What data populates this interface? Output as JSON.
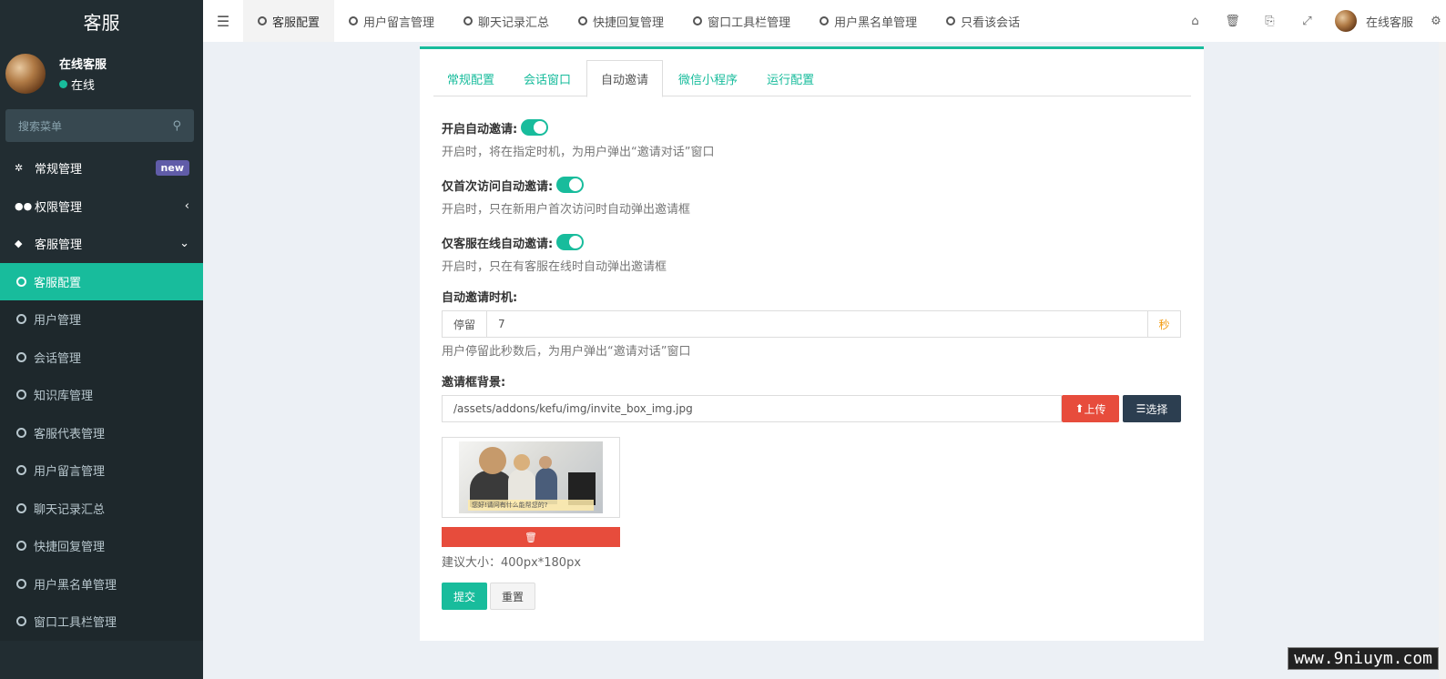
{
  "sidebar": {
    "logo": "客服",
    "user": {
      "name": "在线客服",
      "status": "在线"
    },
    "search_placeholder": "搜索菜单",
    "menu": [
      {
        "label": "常规管理",
        "icon": "gears-icon",
        "badge": "new"
      },
      {
        "label": "权限管理",
        "icon": "users-icon",
        "arrow": "‹"
      },
      {
        "label": "客服管理",
        "icon": "comment-icon",
        "arrow": "⌄"
      }
    ],
    "submenu": [
      {
        "label": "客服配置",
        "active": true
      },
      {
        "label": "用户管理"
      },
      {
        "label": "会话管理"
      },
      {
        "label": "知识库管理"
      },
      {
        "label": "客服代表管理"
      },
      {
        "label": "用户留言管理"
      },
      {
        "label": "聊天记录汇总"
      },
      {
        "label": "快捷回复管理"
      },
      {
        "label": "用户黑名单管理"
      },
      {
        "label": "窗口工具栏管理"
      }
    ]
  },
  "navbar": {
    "toggle": "☰",
    "tabs": [
      {
        "label": "客服配置",
        "active": true
      },
      {
        "label": "用户留言管理"
      },
      {
        "label": "聊天记录汇总"
      },
      {
        "label": "快捷回复管理"
      },
      {
        "label": "窗口工具栏管理"
      },
      {
        "label": "用户黑名单管理"
      },
      {
        "label": "只看该会话"
      }
    ],
    "icons": [
      "home-icon",
      "trash-icon",
      "translate-icon",
      "fullscreen-icon"
    ],
    "user_name": "在线客服"
  },
  "panel": {
    "tabs": [
      {
        "label": "常规配置"
      },
      {
        "label": "会话窗口"
      },
      {
        "label": "自动邀请",
        "active": true
      },
      {
        "label": "微信小程序"
      },
      {
        "label": "运行配置"
      }
    ],
    "fields": {
      "auto_invite": {
        "label": "开启自动邀请:",
        "enabled": true,
        "help": "开启时，将在指定时机，为用户弹出“邀请对话”窗口"
      },
      "first_visit": {
        "label": "仅首次访问自动邀请:",
        "enabled": true,
        "help": "开启时，只在新用户首次访问时自动弹出邀请框"
      },
      "online_only": {
        "label": "仅客服在线自动邀请:",
        "enabled": true,
        "help": "开启时，只在有客服在线时自动弹出邀请框"
      },
      "timing": {
        "label": "自动邀请时机:",
        "prefix": "停留",
        "value": "7",
        "suffix": "秒",
        "help": "用户停留此秒数后，为用户弹出“邀请对话”窗口"
      },
      "background": {
        "label": "邀请框背景:",
        "value": "/assets/addons/kefu/img/invite_box_img.jpg",
        "upload_label": "上传",
        "select_label": "选择",
        "preview_caption": "您好!请问有什么能帮您的?",
        "size_tip": "建议大小：400px*180px"
      }
    },
    "submit_label": "提交",
    "reset_label": "重置"
  },
  "watermark": "www.9niuym.com",
  "colors": {
    "accent": "#18bc9c",
    "sidebar_bg": "#222d32",
    "danger": "#e74c3c",
    "dark": "#2c3e50",
    "badge": "#605ca8"
  }
}
